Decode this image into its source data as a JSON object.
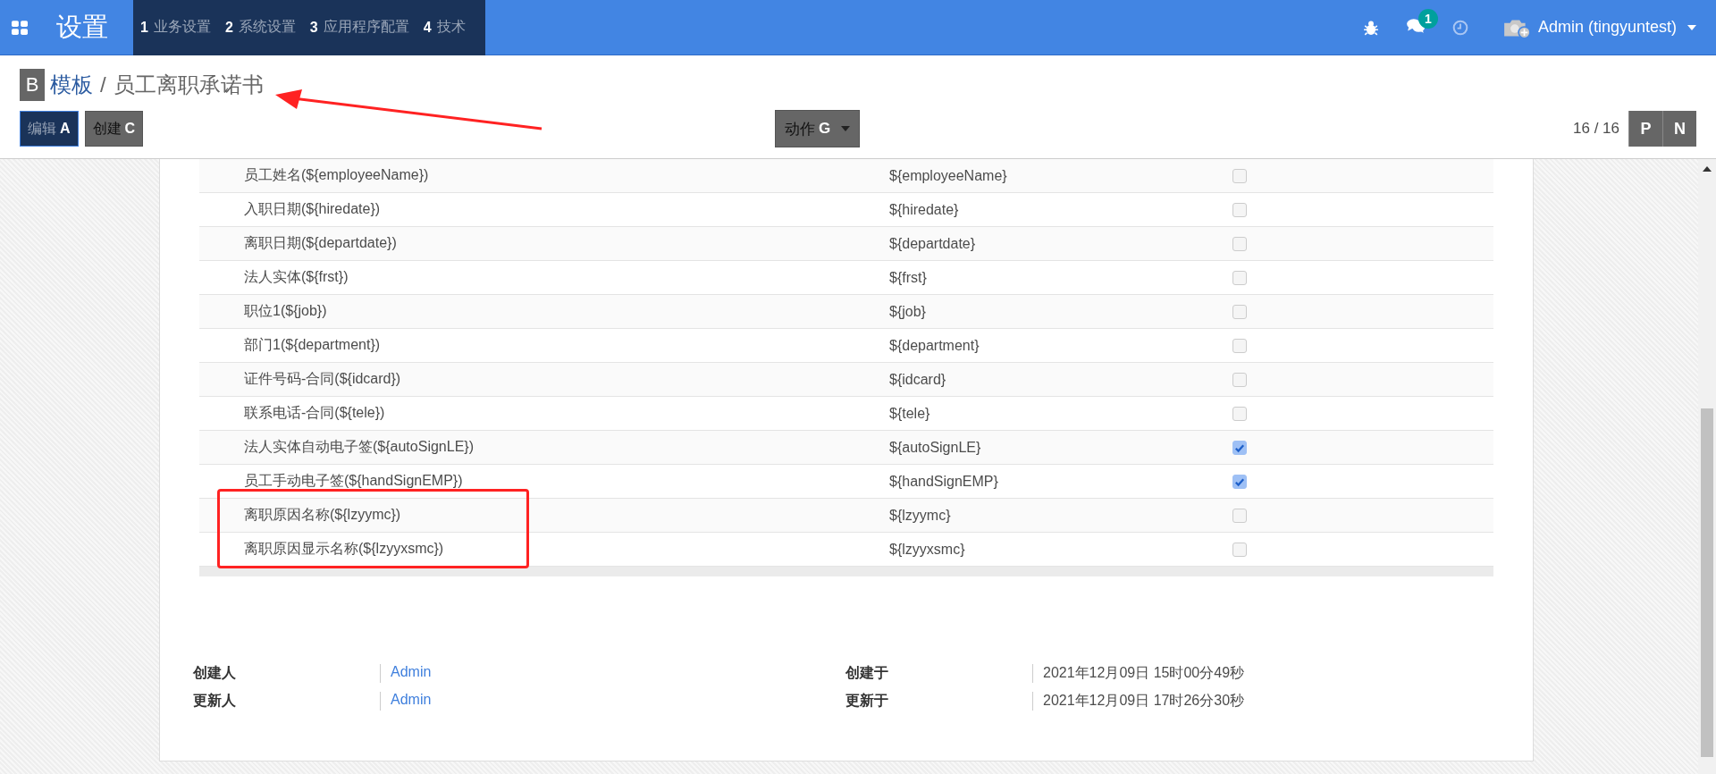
{
  "navbar": {
    "app_title": "设置",
    "menus": [
      {
        "label": "业务设置",
        "hint": "1"
      },
      {
        "label": "系统设置",
        "hint": "2"
      },
      {
        "label": "应用程序配置",
        "hint": "3"
      },
      {
        "label": "技术",
        "hint": "4"
      }
    ],
    "messages_badge": "1",
    "user": "Admin (tingyuntest)"
  },
  "breadcrumb": {
    "parent": "模板",
    "parent_hint": "B",
    "separator": "/",
    "current": "员工离职承诺书"
  },
  "buttons": [
    {
      "label": "编辑",
      "hint": "A",
      "kind": "primary"
    },
    {
      "label": "创建",
      "hint": "C",
      "kind": "secondary"
    }
  ],
  "action": {
    "label": "动作",
    "hint": "G"
  },
  "pager": {
    "value": "16 / 16",
    "prev_hint": "P",
    "next_hint": "N"
  },
  "table": {
    "rows": [
      {
        "label": "员工姓名(${employeeName})",
        "value": "${employeeName}",
        "checked": false
      },
      {
        "label": "入职日期(${hiredate})",
        "value": "${hiredate}",
        "checked": false
      },
      {
        "label": "离职日期(${departdate})",
        "value": "${departdate}",
        "checked": false
      },
      {
        "label": "法人实体(${frst})",
        "value": "${frst}",
        "checked": false
      },
      {
        "label": "职位1(${job})",
        "value": "${job}",
        "checked": false
      },
      {
        "label": "部门1(${department})",
        "value": "${department}",
        "checked": false
      },
      {
        "label": "证件号码-合同(${idcard})",
        "value": "${idcard}",
        "checked": false
      },
      {
        "label": "联系电话-合同(${tele})",
        "value": "${tele}",
        "checked": false
      },
      {
        "label": "法人实体自动电子签(${autoSignLE})",
        "value": "${autoSignLE}",
        "checked": true
      },
      {
        "label": "员工手动电子签(${handSignEMP})",
        "value": "${handSignEMP}",
        "checked": true
      },
      {
        "label": "离职原因名称(${lzyymc})",
        "value": "${lzyymc}",
        "checked": false
      },
      {
        "label": "离职原因显示名称(${lzyyxsmc})",
        "value": "${lzyyxsmc}",
        "checked": false
      }
    ]
  },
  "footer": [
    {
      "label": "创建人",
      "user": "Admin",
      "time_label": "创建于",
      "time": "2021年12月09日 15时00分49秒"
    },
    {
      "label": "更新人",
      "user": "Admin",
      "time_label": "更新于",
      "time": "2021年12月09日 17时26分30秒"
    }
  ]
}
